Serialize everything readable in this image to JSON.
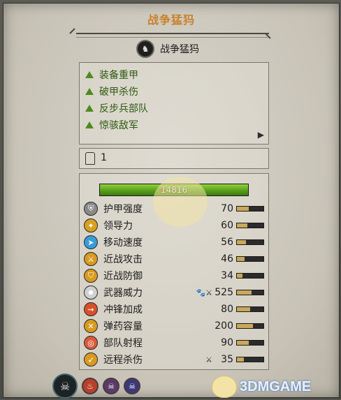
{
  "header": {
    "title": "战争猛犸"
  },
  "unit": {
    "name": "战争猛犸",
    "icon": "mammoth-icon"
  },
  "abilities": [
    {
      "label": "装备重甲",
      "icon": "green-triangle-icon"
    },
    {
      "label": "破甲杀伤",
      "icon": "green-triangle-icon"
    },
    {
      "label": "反步兵部队",
      "icon": "green-triangle-icon"
    },
    {
      "label": "惊骇敌军",
      "icon": "green-triangle-icon"
    }
  ],
  "expand_arrow": "▶",
  "rank": {
    "value": "1",
    "icon": "rank-chevron-icon"
  },
  "health": {
    "label": "14816",
    "fraction": 1.0,
    "color": "#6bb52a"
  },
  "stats": [
    {
      "name": "护甲强度",
      "value": "70",
      "extra": "",
      "fraction": 0.45,
      "icon": "armor-icon",
      "color": "#8a8a8a"
    },
    {
      "name": "领导力",
      "value": "60",
      "extra": "",
      "fraction": 0.4,
      "icon": "leadership-icon",
      "color": "#d8a020"
    },
    {
      "name": "移动速度",
      "value": "56",
      "extra": "",
      "fraction": 0.35,
      "icon": "speed-icon",
      "color": "#3a9bd8"
    },
    {
      "name": "近战攻击",
      "value": "46",
      "extra": "",
      "fraction": 0.3,
      "icon": "melee-attack-icon",
      "color": "#d89a20"
    },
    {
      "name": "近战防御",
      "value": "34",
      "extra": "",
      "fraction": 0.22,
      "icon": "melee-defense-icon",
      "color": "#d89a20"
    },
    {
      "name": "武器威力",
      "value": "525",
      "extra": "🐾⚔",
      "fraction": 0.55,
      "icon": "weapon-strength-icon",
      "color": "#d0d0d0"
    },
    {
      "name": "冲锋加成",
      "value": "80",
      "extra": "",
      "fraction": 0.5,
      "icon": "charge-bonus-icon",
      "color": "#d8502a"
    },
    {
      "name": "弹药容量",
      "value": "200",
      "extra": "",
      "fraction": 0.6,
      "icon": "ammunition-icon",
      "color": "#d89a20"
    },
    {
      "name": "部队射程",
      "value": "90",
      "extra": "",
      "fraction": 0.45,
      "icon": "range-icon",
      "color": "#d85a3a"
    },
    {
      "name": "远程杀伤",
      "value": "35",
      "extra": "⚔",
      "fraction": 0.25,
      "icon": "missile-damage-icon",
      "color": "#d89a20"
    }
  ],
  "bottom_icons": [
    {
      "name": "faction-skull-icon",
      "glyph": "☠",
      "color": "#2a2a2a"
    },
    {
      "name": "fire-spell-icon",
      "glyph": "♨",
      "color": "#b8402a"
    },
    {
      "name": "skull-spell-icon",
      "glyph": "☠",
      "color": "#5a3a6a"
    },
    {
      "name": "death-spell-icon",
      "glyph": "☠",
      "color": "#3a3a7a"
    }
  ],
  "watermark": {
    "text": "3DMGAME"
  }
}
